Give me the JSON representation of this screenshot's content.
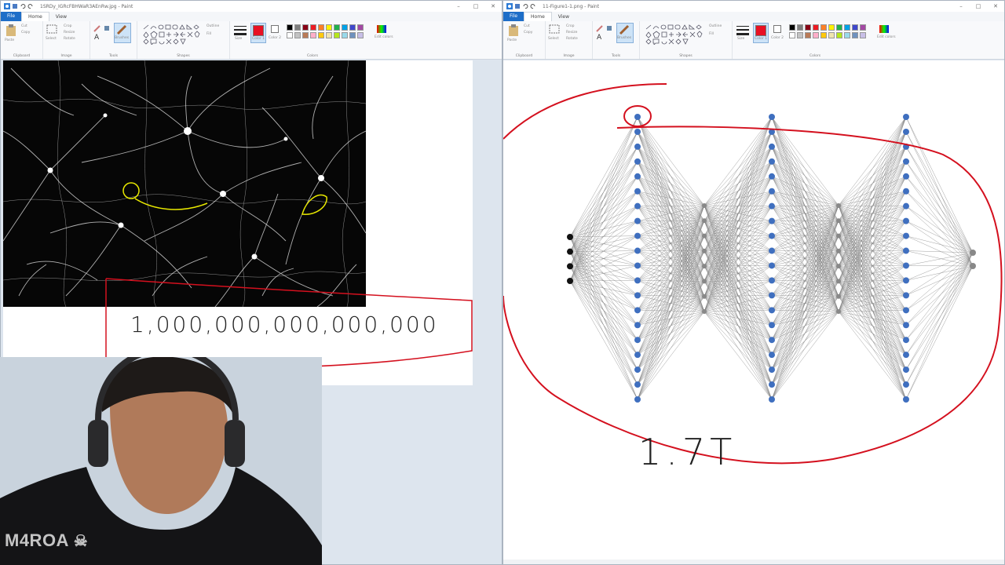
{
  "left_window": {
    "title": "1SRDy_IGRcFBHWaR3AEnRw.jpg - Paint",
    "tabs": [
      "File",
      "Home",
      "View"
    ],
    "ribbon_groups": [
      "Clipboard",
      "Image",
      "Tools",
      "Shapes",
      "Colors"
    ],
    "ribbon_buttons": {
      "paste": "Paste",
      "cut": "Cut",
      "copy": "Copy",
      "crop": "Crop",
      "resize": "Resize",
      "rotate": "Rotate",
      "select": "Select",
      "brushes": "Brushes",
      "outline": "Outline",
      "fill": "Fill",
      "size": "Size",
      "color1": "Color 1",
      "color2": "Color 2",
      "edit_colors": "Edit colors"
    },
    "annotation": "1,000,000,000,000,000"
  },
  "right_window": {
    "title": "11-Figure1-1.png - Paint",
    "tabs": [
      "File",
      "Home",
      "View"
    ],
    "ribbon_groups": [
      "Clipboard",
      "Image",
      "Tools",
      "Shapes",
      "Colors"
    ],
    "ribbon_buttons": {
      "paste": "Paste",
      "cut": "Cut",
      "copy": "Copy",
      "crop": "Crop",
      "resize": "Resize",
      "rotate": "Rotate",
      "select": "Select",
      "brushes": "Brushes",
      "outline": "Outline",
      "fill": "Fill",
      "size": "Size",
      "color1": "Color 1",
      "color2": "Color 2",
      "edit_colors": "Edit colors"
    },
    "annotation": "1.7T"
  },
  "palette": [
    "#000000",
    "#7f7f7f",
    "#880015",
    "#ed1c24",
    "#ff7f27",
    "#fff200",
    "#22b14c",
    "#00a2e8",
    "#3f48cc",
    "#a349a4",
    "#ffffff",
    "#c3c3c3",
    "#b97a57",
    "#ffaec9",
    "#ffc90e",
    "#efe4b0",
    "#b5e61d",
    "#99d9ea",
    "#7092be",
    "#c8bfe7"
  ],
  "colors": {
    "selected": "#e81123",
    "node_blue": "#3f6fbf",
    "pen_red": "#d4101e",
    "pen_yellow": "#e8e800"
  },
  "watermark": "M4ROA"
}
